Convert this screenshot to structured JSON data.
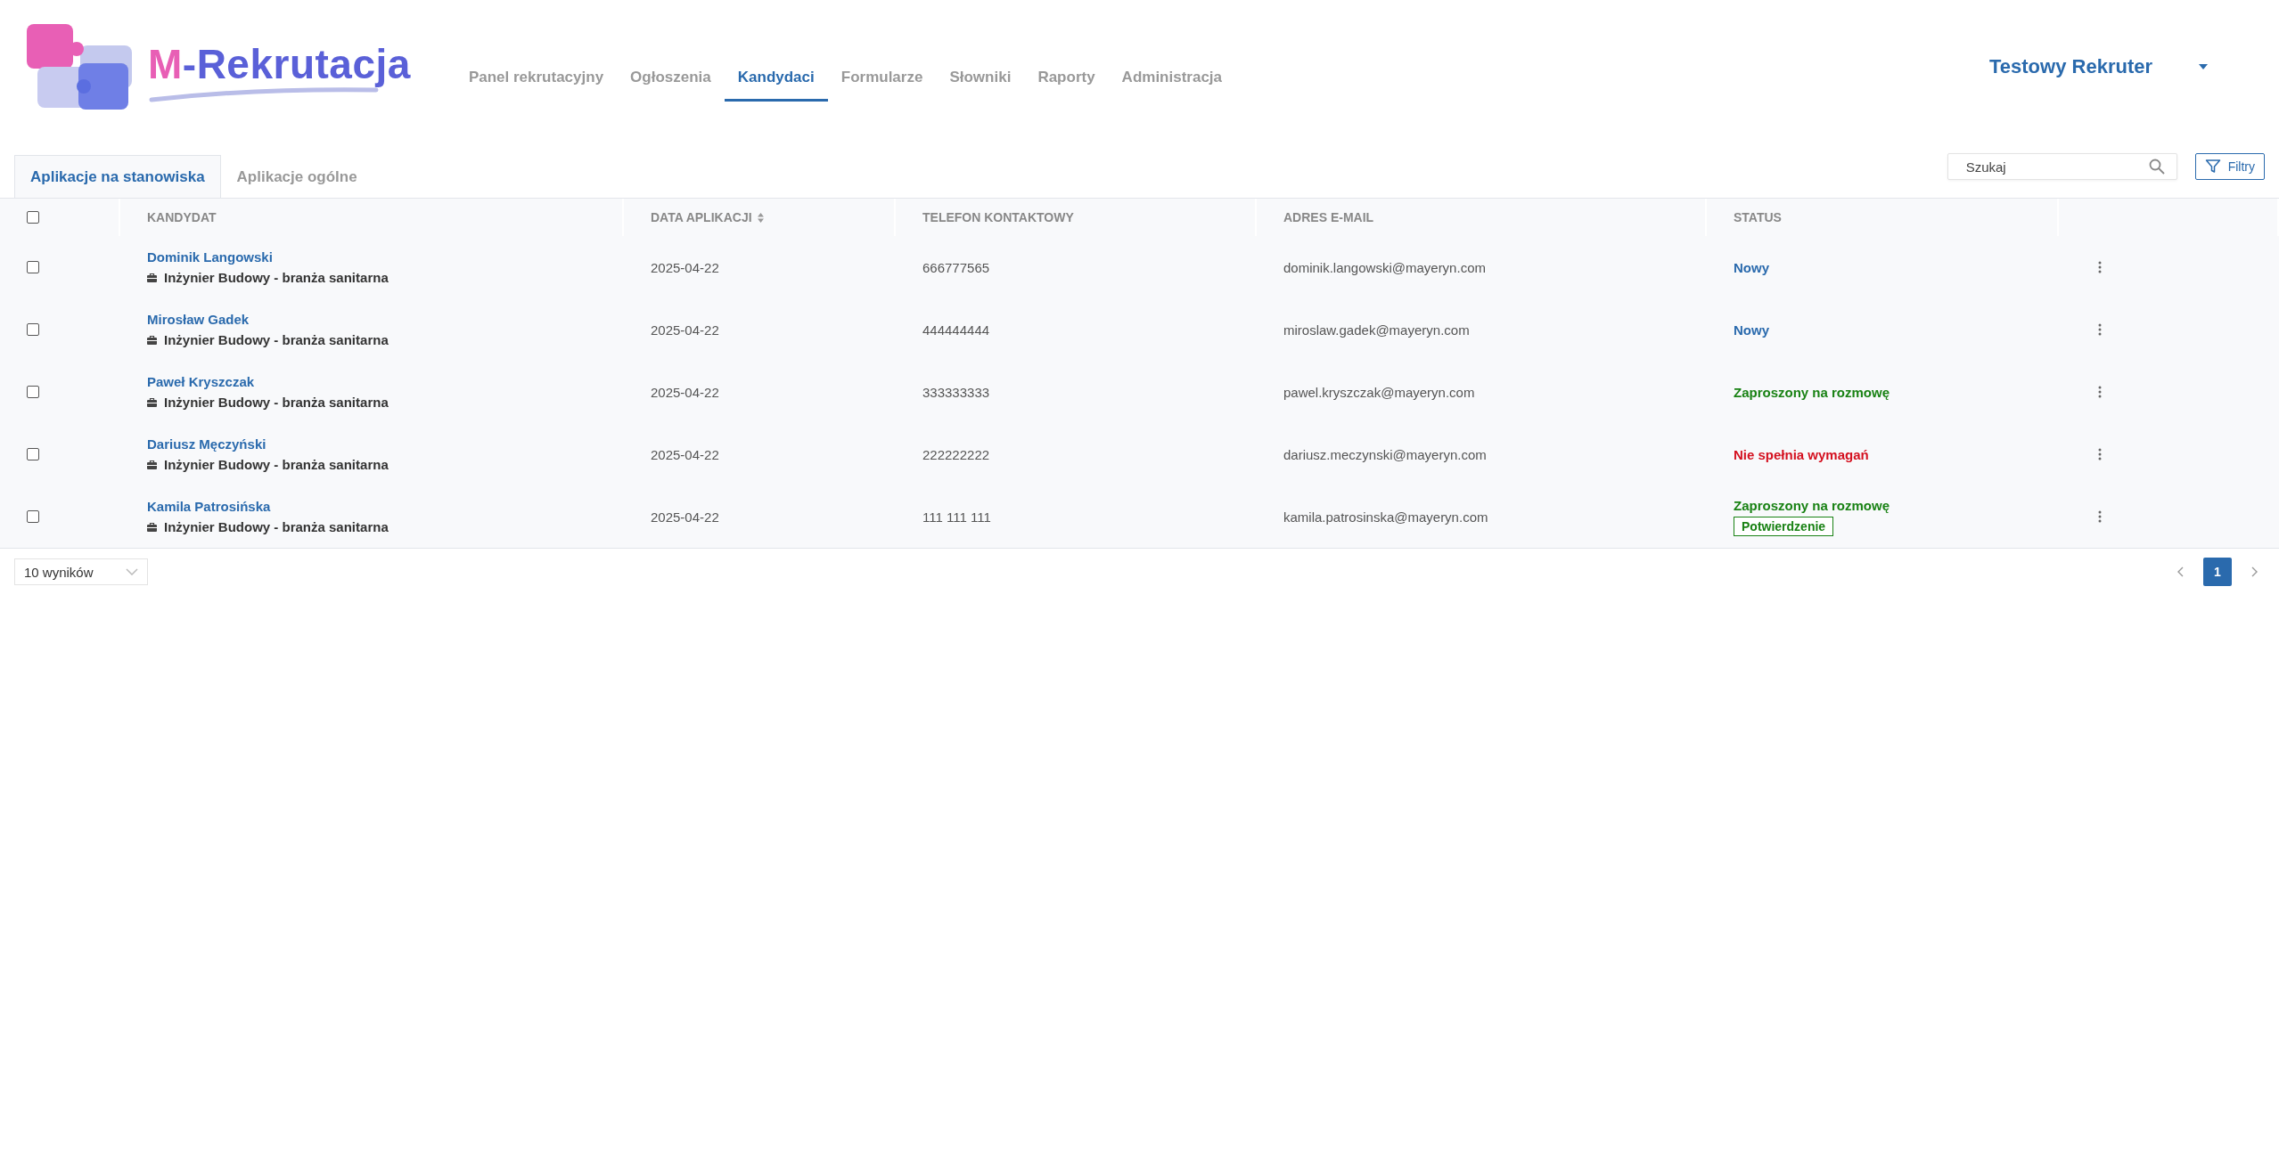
{
  "logo": {
    "parts": [
      {
        "text": "M",
        "kind": "accent"
      },
      {
        "text": "-Rekrutacja",
        "kind": "main"
      }
    ]
  },
  "nav": [
    {
      "label": "Panel rekrutacyjny",
      "selected": false
    },
    {
      "label": "Ogłoszenia",
      "selected": false
    },
    {
      "label": "Kandydaci",
      "selected": true
    },
    {
      "label": "Formularze",
      "selected": false
    },
    {
      "label": "Słowniki",
      "selected": false
    },
    {
      "label": "Raporty",
      "selected": false
    },
    {
      "label": "Administracja",
      "selected": false
    }
  ],
  "user": {
    "name": "Testowy Rekruter"
  },
  "tabs": [
    {
      "label": "Aplikacje na stanowiska",
      "selected": true
    },
    {
      "label": "Aplikacje ogólne",
      "selected": false
    }
  ],
  "search": {
    "placeholder": "Szukaj"
  },
  "filter_button": "Filtry",
  "table": {
    "select_all_checked": false,
    "columns": [
      {
        "label": "KANDYDAT",
        "sortable": false
      },
      {
        "label": "DATA APLIKACJI",
        "sortable": true
      },
      {
        "label": "TELEFON KONTAKTOWY",
        "sortable": false
      },
      {
        "label": "ADRES E-MAIL",
        "sortable": false
      },
      {
        "label": "STATUS",
        "sortable": false
      }
    ],
    "rows": [
      {
        "checked": false,
        "name": "Dominik Langowski",
        "position": "Inżynier Budowy - branża sanitarna",
        "date": "2025-04-22",
        "phone": "666777565",
        "email": "dominik.langowski@mayeryn.com",
        "status": "Nowy",
        "color": "#2a6aad"
      },
      {
        "checked": false,
        "name": "Mirosław Gadek",
        "position": "Inżynier Budowy - branża sanitarna",
        "date": "2025-04-22",
        "phone": "444444444",
        "email": "miroslaw.gadek@mayeryn.com",
        "status": "Nowy",
        "color": "#2a6aad"
      },
      {
        "checked": false,
        "name": "Paweł Kryszczak",
        "position": "Inżynier Budowy - branża sanitarna",
        "date": "2025-04-22",
        "phone": "333333333",
        "email": "pawel.kryszczak@mayeryn.com",
        "status": "Zaproszony na rozmowę",
        "color": "#198214"
      },
      {
        "checked": false,
        "name": "Dariusz Męczyński",
        "position": "Inżynier Budowy - branża sanitarna",
        "date": "2025-04-22",
        "phone": "222222222",
        "email": "dariusz.meczynski@mayeryn.com",
        "status": "Nie spełnia wymagań",
        "color": "#d4101f"
      },
      {
        "checked": false,
        "name": "Kamila Patrosińska",
        "position": "Inżynier Budowy - branża sanitarna",
        "date": "2025-04-22",
        "phone": "111 111 111",
        "email": "kamila.patrosinska@mayeryn.com",
        "status": "Zaproszony na rozmowę",
        "color": "#198214",
        "tag": "Potwierdzenie"
      }
    ]
  },
  "page_size": "10 wyników",
  "pagination": [
    {
      "label": "1",
      "selected": true
    }
  ]
}
